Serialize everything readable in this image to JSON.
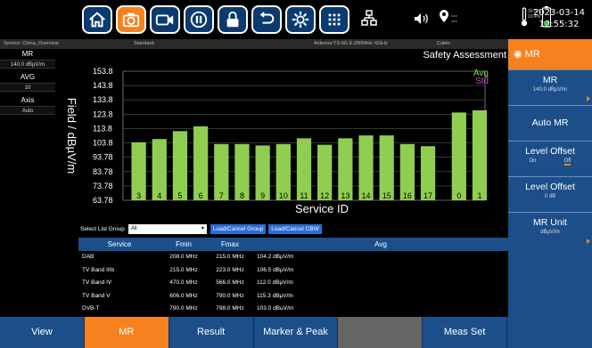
{
  "toolbar": {
    "buttons": [
      {
        "name": "home-icon",
        "active": false
      },
      {
        "name": "camera-icon",
        "active": true
      },
      {
        "name": "video-icon",
        "active": false
      },
      {
        "name": "pause-icon",
        "active": false
      },
      {
        "name": "lock-icon",
        "active": false
      },
      {
        "name": "undo-icon",
        "active": false
      },
      {
        "name": "gear-icon",
        "active": false
      },
      {
        "name": "keypad-icon",
        "active": false
      }
    ],
    "status_icons": [
      "network-icon",
      "volume-icon",
      "location-icon",
      "temperature-icon",
      "battery-icon"
    ],
    "battery_info": [
      "30.5°C",
      "19.4%"
    ],
    "date": "2023-03-14",
    "time": "12:55:32"
  },
  "infobar": {
    "service": "Service: China_Overview",
    "standard": "Standard:",
    "antenna": "Antenna:TS-6G E:200MHz~6GHz",
    "cable": "Cable:"
  },
  "left_panel": {
    "mr_label": "MR",
    "mr_value": "140.0 dBµV/m",
    "avg_label": "AVG",
    "avg_value": "10",
    "axis_label": "Axis",
    "axis_value": "Auto"
  },
  "page_title": "Safety Assessment",
  "chart_data": {
    "type": "bar",
    "ylabel": "Field / dBµV/m",
    "xlabel": "Service ID",
    "ytick_labels": [
      "153.8",
      "143.8",
      "133.8",
      "123.8",
      "113.8",
      "103.8",
      "93.78",
      "83.78",
      "73.78",
      "63.78"
    ],
    "ylim": [
      63.78,
      153.8
    ],
    "categories": [
      "3",
      "4",
      "5",
      "6",
      "7",
      "8",
      "9",
      "10",
      "11",
      "12",
      "13",
      "14",
      "15",
      "16",
      "17",
      "0",
      "1"
    ],
    "series": [
      {
        "name": "Avg",
        "color": "#8fce50",
        "values": [
          104.2,
          106.5,
          112.0,
          115.3,
          103.0,
          103.0,
          102.0,
          103.0,
          107.0,
          102.5,
          107.0,
          109.0,
          109.0,
          103.0,
          101.5,
          125.0,
          126.5
        ]
      }
    ],
    "legend": [
      {
        "label": "Avg",
        "color": "#8fce50"
      },
      {
        "label": "Std",
        "color": "#c050c8"
      }
    ],
    "legend_position": "top-right",
    "grid": true
  },
  "controls": {
    "select_label": "Select List Group",
    "select_value": "All",
    "load_group": "Load/Cancel Group",
    "load_cbw": "Load/Cancel CBW"
  },
  "table": {
    "headers": [
      "Service",
      "Fmin",
      "Fmax",
      "Avg"
    ],
    "rows": [
      [
        "DAB",
        "208.0 MHz",
        "215.0 MHz",
        "104.2 dBµV/m"
      ],
      [
        "TV Band IIIb",
        "215.0 MHz",
        "223.0 MHz",
        "106.5 dBµV/m"
      ],
      [
        "TV Band IV",
        "470.0 MHz",
        "566.0 MHz",
        "112.0 dBµV/m"
      ],
      [
        "TV Band V",
        "606.0 MHz",
        "790.0 MHz",
        "115.3 dBµV/m"
      ],
      [
        "DVB-T",
        "790.0 MHz",
        "798.0 MHz",
        "103.0 dBµV/m"
      ]
    ]
  },
  "right_panel": {
    "header": "MR",
    "buttons": [
      {
        "title": "MR",
        "sub": "140.0 dBµV/m"
      },
      {
        "title": "Auto MR",
        "sub": ""
      },
      {
        "title": "Level Offset",
        "sub_on": "On",
        "sub_off": "Off"
      },
      {
        "title": "Level Offset",
        "sub": "0 dB"
      },
      {
        "title": "MR Unit",
        "sub": "dBµV/m"
      }
    ]
  },
  "bottom_tabs": [
    "View",
    "MR",
    "Result",
    "Marker & Peak",
    "",
    "Meas Set"
  ],
  "colors": {
    "accent": "#f5821f",
    "panel_blue": "#1c4f8a",
    "bar_green": "#8fce50"
  }
}
